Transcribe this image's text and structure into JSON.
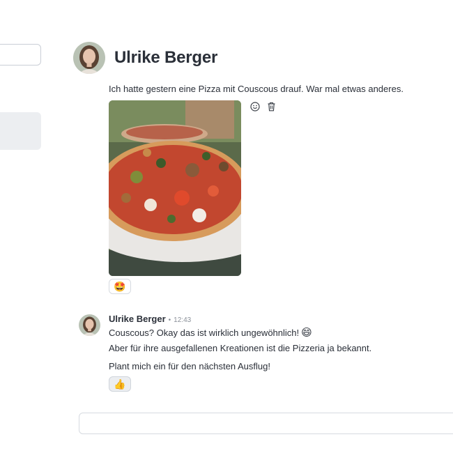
{
  "channel": {
    "title": "Ulrike Berger"
  },
  "messages": [
    {
      "text": "Ich hatte gestern eine Pizza mit Couscous drauf. War mal etwas anderes.",
      "attachment": {
        "type": "photo",
        "subject": "pizza-photo"
      },
      "actions": {
        "react_icon": "smile-icon",
        "delete_icon": "trash-icon"
      },
      "reactions": [
        {
          "emoji": "🤩"
        }
      ]
    },
    {
      "author": "Ulrike Berger",
      "separator": "•",
      "time": "12:43",
      "line1": "Couscous? Okay das ist wirklich ungewöhnlich!",
      "line1_emoji": "😄",
      "line2": "Aber für ihre ausgefallenen Kreationen ist die Pizzeria ja bekannt.",
      "line3": "Plant mich ein für den nächsten Ausflug!",
      "reactions": [
        {
          "emoji": "👍"
        }
      ]
    }
  ],
  "composer": {
    "placeholder": ""
  }
}
